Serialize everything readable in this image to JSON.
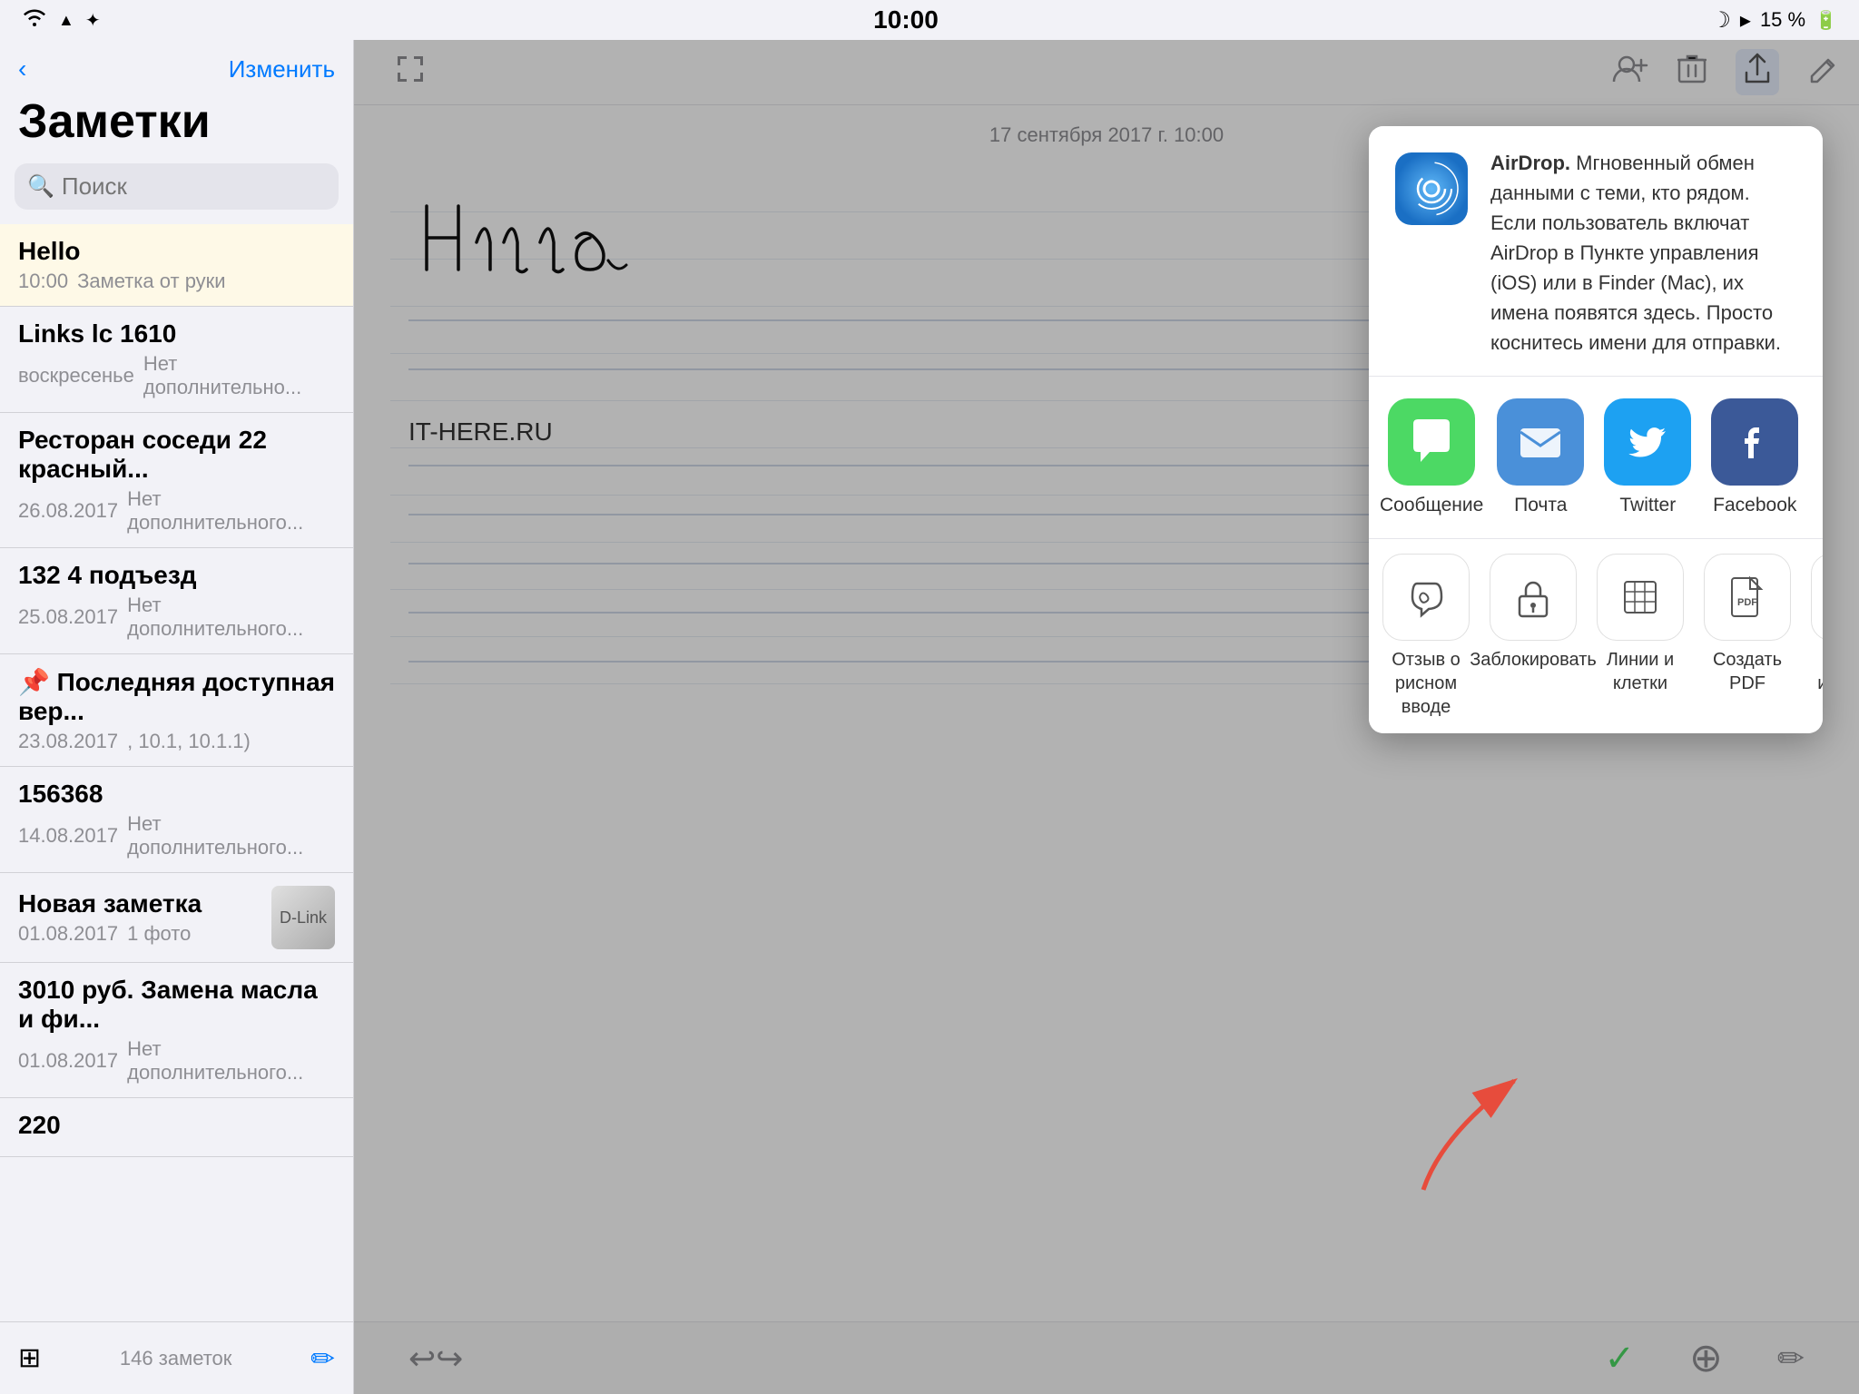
{
  "statusBar": {
    "time": "10:00",
    "battery": "15 %",
    "icons": [
      "wifi",
      "arrow-up",
      "bluetooth"
    ]
  },
  "sidebar": {
    "backLabel": "‹",
    "editLabel": "Изменить",
    "title": "Заметки",
    "searchPlaceholder": "Поиск",
    "footerCount": "146 заметок",
    "notes": [
      {
        "id": 1,
        "title": "Hello",
        "date": "10:00",
        "preview": "Заметка от руки",
        "selected": true,
        "thumb": null
      },
      {
        "id": 2,
        "title": "Links lc 1610",
        "date": "воскресенье",
        "preview": "Нет дополнительно...",
        "selected": false,
        "thumb": null
      },
      {
        "id": 3,
        "title": "Ресторан соседи 22 красный...",
        "date": "26.08.2017",
        "preview": "Нет дополнительного...",
        "selected": false,
        "thumb": null
      },
      {
        "id": 4,
        "title": "132 4 подъезд",
        "date": "25.08.2017",
        "preview": "Нет дополнительного...",
        "selected": false,
        "thumb": null
      },
      {
        "id": 5,
        "title": "📌 Последняя доступная вер...",
        "date": "23.08.2017",
        "preview": ", 10.1, 10.1.1)",
        "selected": false,
        "thumb": null
      },
      {
        "id": 6,
        "title": "156368",
        "date": "14.08.2017",
        "preview": "Нет дополнительного...",
        "selected": false,
        "thumb": null
      },
      {
        "id": 7,
        "title": "Новая заметка",
        "date": "01.08.2017",
        "preview": "1 фото",
        "selected": false,
        "thumb": "dlink"
      },
      {
        "id": 8,
        "title": "3010 руб. Замена масла и фи...",
        "date": "01.08.2017",
        "preview": "Нет дополнительного...",
        "selected": false,
        "thumb": null
      },
      {
        "id": 9,
        "title": "220",
        "date": "",
        "preview": "",
        "selected": false,
        "thumb": null
      }
    ]
  },
  "noteDetail": {
    "dateHeader": "17 сентября 2017 г. 10:00",
    "noteUrl": "IT-HERE.RU",
    "helloText": "Hello"
  },
  "shareSheet": {
    "airdrop": {
      "title": "AirDrop.",
      "description": " Мгновенный обмен данными с теми, кто рядом. Если пользователь включат AirDrop в Пункте управления (iOS) или в Finder (Mac), их имена появятся здесь. Просто коснитесь имени для отправки."
    },
    "apps": [
      {
        "id": "messages",
        "label": "Сообщение",
        "color": "#4cd964"
      },
      {
        "id": "mail",
        "label": "Почта",
        "color": "#4a90d9"
      },
      {
        "id": "twitter",
        "label": "Twitter",
        "color": "#1da1f2"
      },
      {
        "id": "facebook",
        "label": "Facebook",
        "color": "#3b5998"
      }
    ],
    "actions": [
      {
        "id": "feedback",
        "label": "Отзыв о рисном вводе"
      },
      {
        "id": "lock",
        "label": "Заблокировать"
      },
      {
        "id": "lines",
        "label": "Линии и клетки"
      },
      {
        "id": "pdf",
        "label": "Создать PDF"
      },
      {
        "id": "save",
        "label": "Сохр. изобра..."
      }
    ]
  },
  "bottomToolbar": {
    "undoLabel": "↩",
    "redoLabel": "↪",
    "checkLabel": "✓",
    "addLabel": "+",
    "editLabel": "✏"
  }
}
